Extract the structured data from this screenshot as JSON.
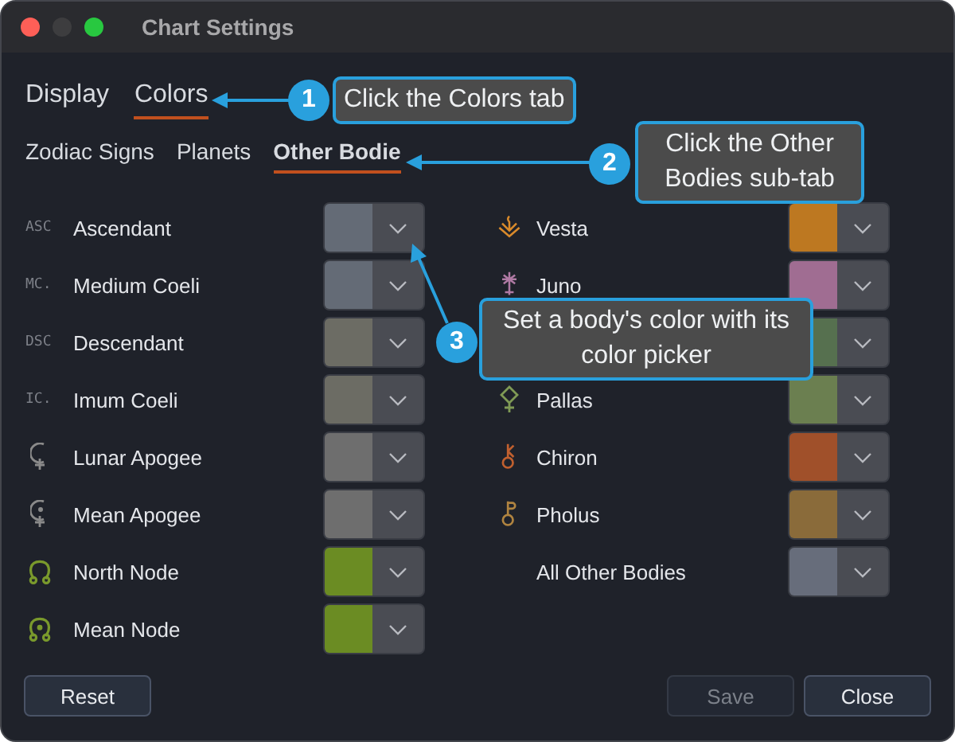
{
  "window": {
    "title": "Chart Settings"
  },
  "tabs": [
    {
      "label": "Display",
      "selected": false
    },
    {
      "label": "Colors",
      "selected": true
    }
  ],
  "sub_tabs": [
    {
      "label": "Zodiac Signs",
      "selected": false
    },
    {
      "label": "Planets",
      "selected": false
    },
    {
      "label": "Other Bodie",
      "selected": true
    }
  ],
  "left_rows": [
    {
      "kind": "text",
      "symbol": "ASC",
      "name": "Ascendant",
      "color": "#646b76"
    },
    {
      "kind": "text",
      "symbol": "MC.",
      "name": "Medium Coeli",
      "color": "#646b76"
    },
    {
      "kind": "text",
      "symbol": "DSC",
      "name": "Descendant",
      "color": "#6c6c64"
    },
    {
      "kind": "text",
      "symbol": "IC.",
      "name": "Imum Coeli",
      "color": "#6c6c64"
    },
    {
      "kind": "glyph",
      "name": "Lunar Apogee",
      "color": "#6e6e6e"
    },
    {
      "kind": "glyph",
      "name": "Mean Apogee",
      "color": "#6e6e6e"
    },
    {
      "kind": "glyph",
      "name": "North Node",
      "color": "#6b8c23"
    },
    {
      "kind": "glyph",
      "name": "Mean Node",
      "color": "#6b8c23"
    }
  ],
  "right_rows": [
    {
      "kind": "glyph",
      "name": "Vesta",
      "color": "#bd7821"
    },
    {
      "kind": "glyph",
      "name": "Juno",
      "color": "#a06d92"
    },
    {
      "kind": "hidden",
      "color": "#56704f"
    },
    {
      "kind": "glyph",
      "name": "Pallas",
      "color": "#6b7f50"
    },
    {
      "kind": "glyph",
      "name": "Chiron",
      "color": "#a0502a"
    },
    {
      "kind": "glyph",
      "name": "Pholus",
      "color": "#8a6b3a"
    },
    {
      "kind": "none",
      "name": "All Other Bodies",
      "color": "#676d7b"
    }
  ],
  "buttons": [
    {
      "label": "Reset",
      "disabled": false
    },
    {
      "label": "Save",
      "disabled": true
    },
    {
      "label": "Close",
      "disabled": false
    }
  ],
  "callouts": [
    {
      "number": "1",
      "text": "Click the Colors tab"
    },
    {
      "number": "2",
      "text": "Click the Other Bodies sub-tab"
    },
    {
      "number": "3",
      "text": "Set a body's color with its color picker"
    }
  ]
}
